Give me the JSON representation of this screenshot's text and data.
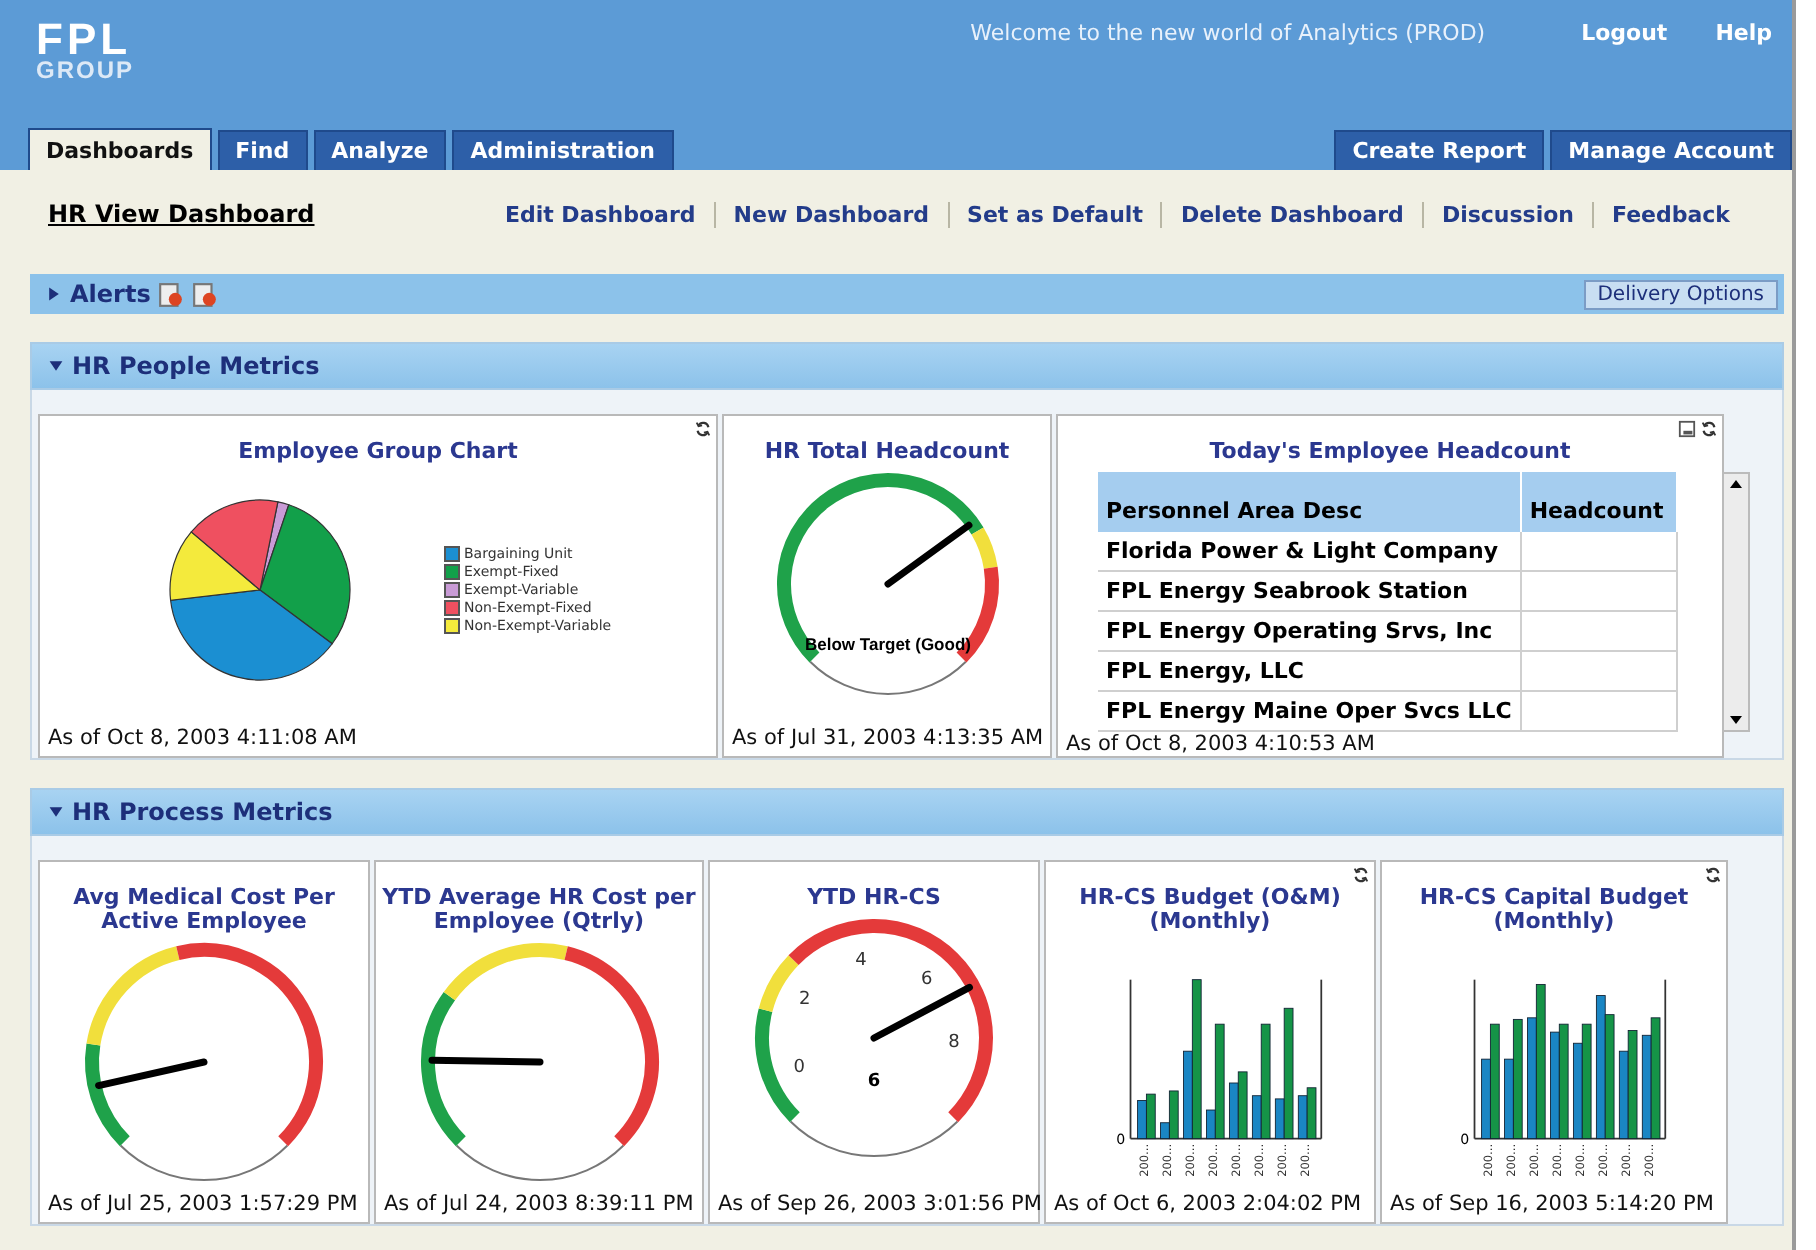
{
  "header": {
    "logo_top": "FPL",
    "logo_bottom": "GROUP",
    "welcome": "Welcome to the new world of Analytics (PROD)",
    "links": [
      "Logout",
      "Help"
    ]
  },
  "tabs": [
    {
      "label": "Dashboards",
      "selected": true
    },
    {
      "label": "Find",
      "selected": false
    },
    {
      "label": "Analyze",
      "selected": false
    },
    {
      "label": "Administration",
      "selected": false
    }
  ],
  "right_tabs": [
    "Create Report",
    "Manage Account"
  ],
  "toolbar": {
    "title": "HR View Dashboard",
    "links": [
      "Edit Dashboard",
      "New Dashboard",
      "Set as Default",
      "Delete Dashboard",
      "Discussion",
      "Feedback"
    ]
  },
  "alerts": {
    "label": "Alerts",
    "expanded": false,
    "button": "Delivery Options"
  },
  "sections": [
    {
      "title": "HR People Metrics",
      "expanded": true,
      "panels": [
        {
          "kind": "pie",
          "title": "Employee Group Chart",
          "timestamp": "As of Oct 8, 2003 4:11:08 AM",
          "legend": [
            {
              "label": "Bargaining Unit",
              "color": "#1b8fd2"
            },
            {
              "label": "Exempt-Fixed",
              "color": "#12a04a"
            },
            {
              "label": "Exempt-Variable",
              "color": "#c99bd6"
            },
            {
              "label": "Non-Exempt-Fixed",
              "color": "#ef5060"
            },
            {
              "label": "Non-Exempt-Variable",
              "color": "#f4ea3c"
            }
          ]
        },
        {
          "kind": "gauge",
          "title": "HR Total Headcount",
          "caption": "Below Target (Good)",
          "timestamp": "As of Jul 31, 2003 4:13:35 AM"
        },
        {
          "kind": "table",
          "title": "Today's Employee Headcount",
          "columns": [
            "Personnel Area Desc",
            "Headcount"
          ],
          "rows": [
            "Florida Power & Light Company",
            "FPL Energy Seabrook Station",
            "FPL Energy Operating Srvs, Inc",
            "FPL Energy, LLC",
            "FPL Energy Maine Oper Svcs LLC"
          ],
          "timestamp": "As of Oct 8, 2003 4:10:53 AM"
        }
      ]
    },
    {
      "title": "HR Process Metrics",
      "expanded": true,
      "panels": [
        {
          "kind": "gauge",
          "title": "Avg Medical Cost Per Active Employee",
          "timestamp": "As of Jul 25, 2003 1:57:29 PM"
        },
        {
          "kind": "gauge",
          "title": "YTD Average HR Cost per Employee (Qtrly)",
          "timestamp": "As of Jul 24, 2003 8:39:11 PM"
        },
        {
          "kind": "gauge",
          "title": "YTD HR-CS",
          "ticks": [
            "0",
            "2",
            "4",
            "6",
            "8"
          ],
          "value": "6",
          "timestamp": "As of Sep 26, 2003 3:01:56 PM"
        },
        {
          "kind": "bars",
          "title": "HR-CS Budget (O&M) (Monthly)",
          "y_label": "0",
          "x_labels": [
            "200...",
            "200...",
            "200...",
            "200...",
            "200...",
            "200...",
            "200...",
            "200..."
          ],
          "timestamp": "As of Oct 6, 2003 2:04:02 PM"
        },
        {
          "kind": "bars",
          "title": "HR-CS Capital Budget (Monthly)",
          "y_label": "0",
          "x_labels": [
            "200...",
            "200...",
            "200...",
            "200...",
            "200...",
            "200...",
            "200...",
            "200..."
          ],
          "timestamp": "As of Sep 16, 2003 5:14:20 PM"
        }
      ]
    }
  ]
}
